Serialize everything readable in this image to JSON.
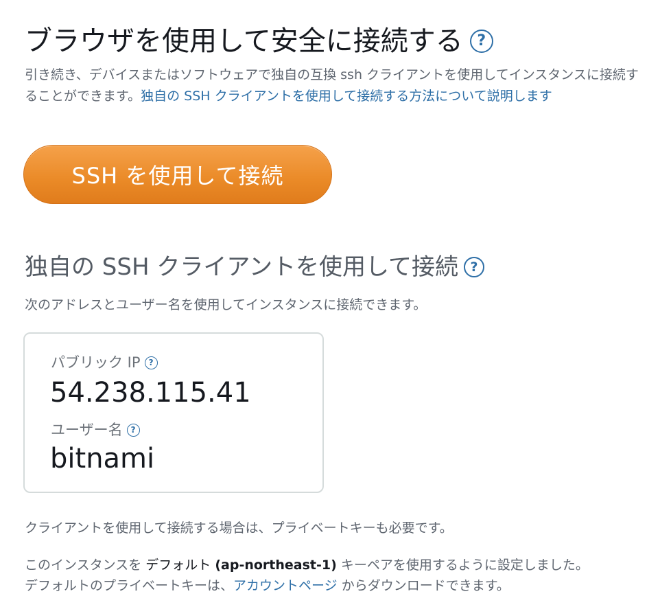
{
  "browser_section": {
    "title": "ブラウザを使用して安全に接続する",
    "help_icon": "?",
    "intro_text": "引き続き、デバイスまたはソフトウェアで独自の互換 ssh クライアントを使用してインスタンスに接続することができます。",
    "intro_link": "独自の SSH クライアントを使用して接続する方法について説明します",
    "connect_button": "SSH を使用して接続",
    "button_color": "#ea8a27"
  },
  "client_section": {
    "title": "独自の SSH クライアントを使用して接続",
    "help_icon": "?",
    "subtitle": "次のアドレスとユーザー名を使用してインスタンスに接続できます。"
  },
  "connection_card": {
    "ip_label": "パブリック IP",
    "ip_value": "54.238.115.41",
    "user_label": "ユーザー名",
    "user_value": "bitnami",
    "help_icon": "?"
  },
  "footer": {
    "private_key_note": "クライアントを使用して接続する場合は、プライベートキーも必要です。",
    "keypair_prefix": "このインスタンスを",
    "keypair_name": "デフォルト",
    "keypair_region": "(ap-northeast-1)",
    "keypair_suffix": "キーペアを使用するように設定しました。",
    "download_prefix": "デフォルトのプライベートキーは、",
    "account_link": "アカウントページ",
    "download_suffix": "からダウンロードできます。"
  },
  "colors": {
    "link": "#2e6fa7",
    "muted_text": "#5f6670"
  }
}
